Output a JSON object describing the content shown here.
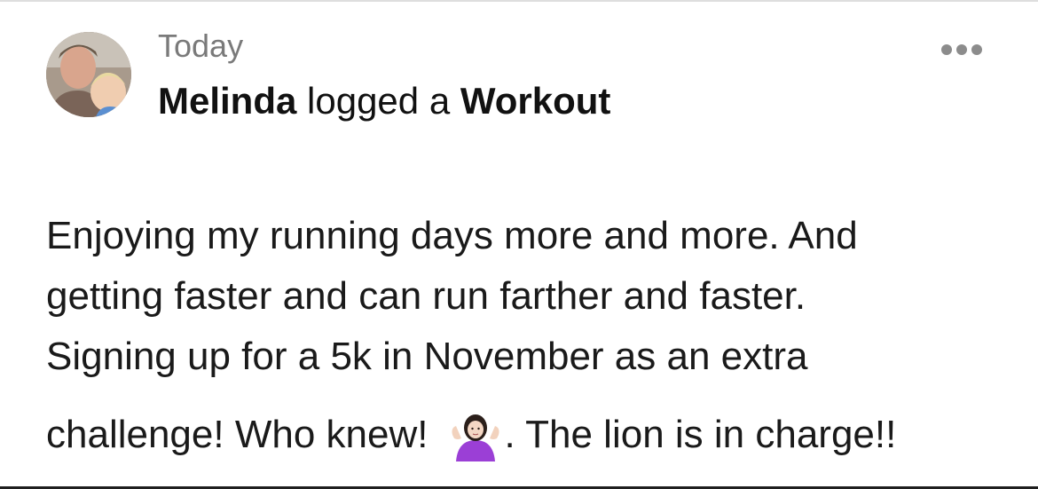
{
  "post": {
    "time": "Today",
    "author": "Melinda",
    "action": " logged a ",
    "object": "Workout",
    "more_icon": "more-horizontal-icon",
    "avatar_icon": "user-avatar",
    "body_lines": [
      "Enjoying my running days more and more.  And",
      "getting faster and can run farther and faster.",
      "Signing up for a 5k in November as an extra"
    ],
    "last_line_before": "challenge!  Who knew!",
    "emoji": "woman-shrugging-emoji",
    "last_line_after": ". The lion is in charge!!"
  }
}
